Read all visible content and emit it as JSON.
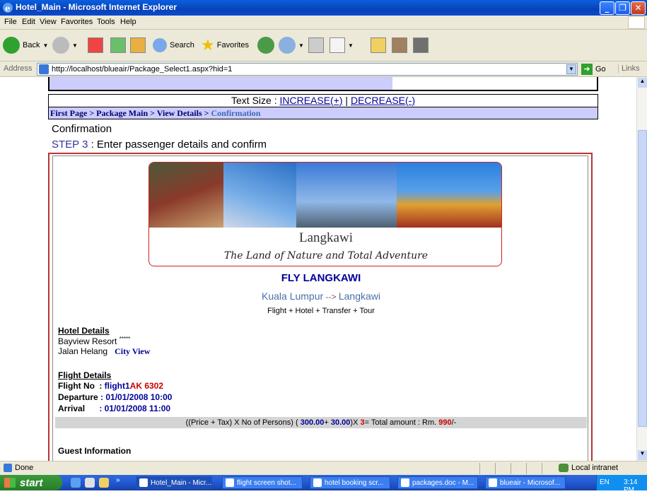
{
  "window": {
    "title": "Hotel_Main - Microsoft Internet Explorer",
    "minimize": "_",
    "maximize": "❐",
    "close": "✕"
  },
  "menu": [
    "File",
    "Edit",
    "View",
    "Favorites",
    "Tools",
    "Help"
  ],
  "toolbar": {
    "back": "Back",
    "search": "Search",
    "favorites": "Favorites"
  },
  "address": {
    "label": "Address",
    "url": "http://localhost/blueair/Package_Select1.aspx?hid=1",
    "go": "Go",
    "links": "Links"
  },
  "page": {
    "text_size_label": "Text Size  : ",
    "increase": "INCREASE(+)",
    "separator": " | ",
    "decrease": "DECREASE(-)",
    "breadcrumb": "First Page  > Package Main > View Details  > ",
    "breadcrumb_current": "Confirmation",
    "confirm_title": "Confirmation",
    "step_no": "STEP 3",
    "step_text": " : Enter passenger details and confirm",
    "banner_destination": "Langkawi",
    "banner_slogan": "The Land of Nature and Total Adventure",
    "package_title": "FLY LANGKAWI",
    "route_from": "Kuala Lumpur",
    "route_arrow": " --> ",
    "route_to": "Langkawi",
    "inclusions": "Flight + Hotel + Transfer + Tour",
    "hotel_heading": "Hotel Details",
    "hotel_name": "Bayview Resort ",
    "hotel_stars": "*****",
    "hotel_address": "Jalan Helang",
    "hotel_view": "City View",
    "flight_heading": "Flight Details",
    "flight_no_label": "Flight No",
    "flight_no_sep": "  : ",
    "flight_no_value": "flight1",
    "flight_code": "AK 6302",
    "departure_label": "Departure",
    "departure_value": " : 01/01/2008 10:00",
    "arrival_label": "Arrival",
    "arrival_value": "  : 01/01/2008 11:00",
    "price_formula_pre": "((Price + Tax) X No of Persons) ( ",
    "price": "300.00",
    "price_plus": "+ ",
    "tax": "30.00",
    "price_mid": ")X ",
    "persons": "3",
    "price_total_label": "= Total amount : Rm. ",
    "total": "990",
    "price_suffix": "/-",
    "guest_heading": "Guest Information"
  },
  "status": {
    "text": "Done",
    "zone": "Local intranet"
  },
  "taskbar": {
    "start": "start",
    "tasks": [
      "Hotel_Main - Micr...",
      "flight screen shot...",
      "hotel booking scr...",
      "packages.doc - M...",
      "blueair - Microsof..."
    ],
    "lang": "EN",
    "clock": "3:14 PM"
  }
}
